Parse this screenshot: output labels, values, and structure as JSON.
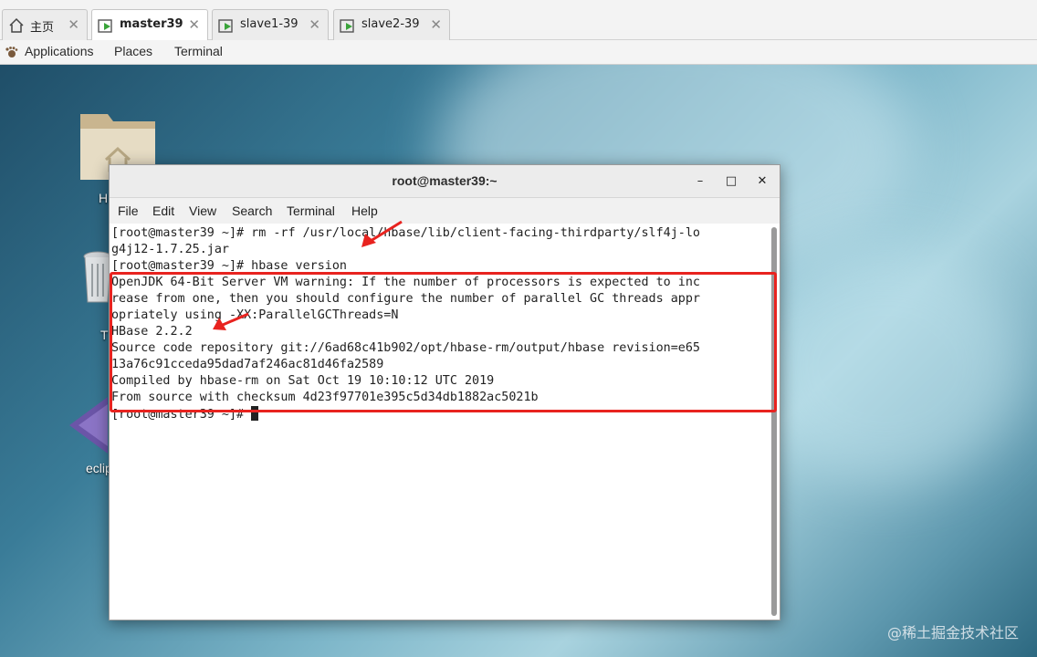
{
  "vm_tabs": [
    {
      "label": "主页",
      "icon": "home-icon"
    },
    {
      "label": "master39",
      "icon": "vm-running-icon",
      "active": true
    },
    {
      "label": "slave1-39",
      "icon": "vm-running-icon"
    },
    {
      "label": "slave2-39",
      "icon": "vm-running-icon"
    }
  ],
  "gnome": {
    "applications": "Applications",
    "places": "Places",
    "terminal": "Terminal"
  },
  "desktop": {
    "icons": [
      {
        "label": "H",
        "icon": "home-folder-icon"
      },
      {
        "label": "T",
        "icon": "trash-icon"
      },
      {
        "label": "eclip",
        "icon": "eclipse-icon"
      }
    ],
    "watermark": "@稀土掘金技术社区"
  },
  "window": {
    "title": "root@master39:~",
    "minimize": "–",
    "maximize": "□",
    "close": "✕"
  },
  "menu": [
    "File",
    "Edit",
    "View",
    "Search",
    "Terminal",
    "Help"
  ],
  "terminal": {
    "lines": [
      "[root@master39 ~]# rm -rf /usr/local/hbase/lib/client-facing-thirdparty/slf4j-lo",
      "g4j12-1.7.25.jar",
      "[root@master39 ~]# hbase version",
      "OpenJDK 64-Bit Server VM warning: If the number of processors is expected to inc",
      "rease from one, then you should configure the number of parallel GC threads appr",
      "opriately using -XX:ParallelGCThreads=N",
      "HBase 2.2.2",
      "Source code repository git://6ad68c41b902/opt/hbase-rm/output/hbase revision=e65",
      "13a76c91cceda95dad7af246ac81d46fa2589",
      "Compiled by hbase-rm on Sat Oct 19 10:10:12 UTC 2019",
      "From source with checksum 4d23f97701e395c5d34db1882ac5021b",
      "[root@master39 ~]# "
    ]
  },
  "colors": {
    "annotation": "#e8231f",
    "terminal_bg": "#ffffff",
    "terminal_fg": "#222222"
  }
}
